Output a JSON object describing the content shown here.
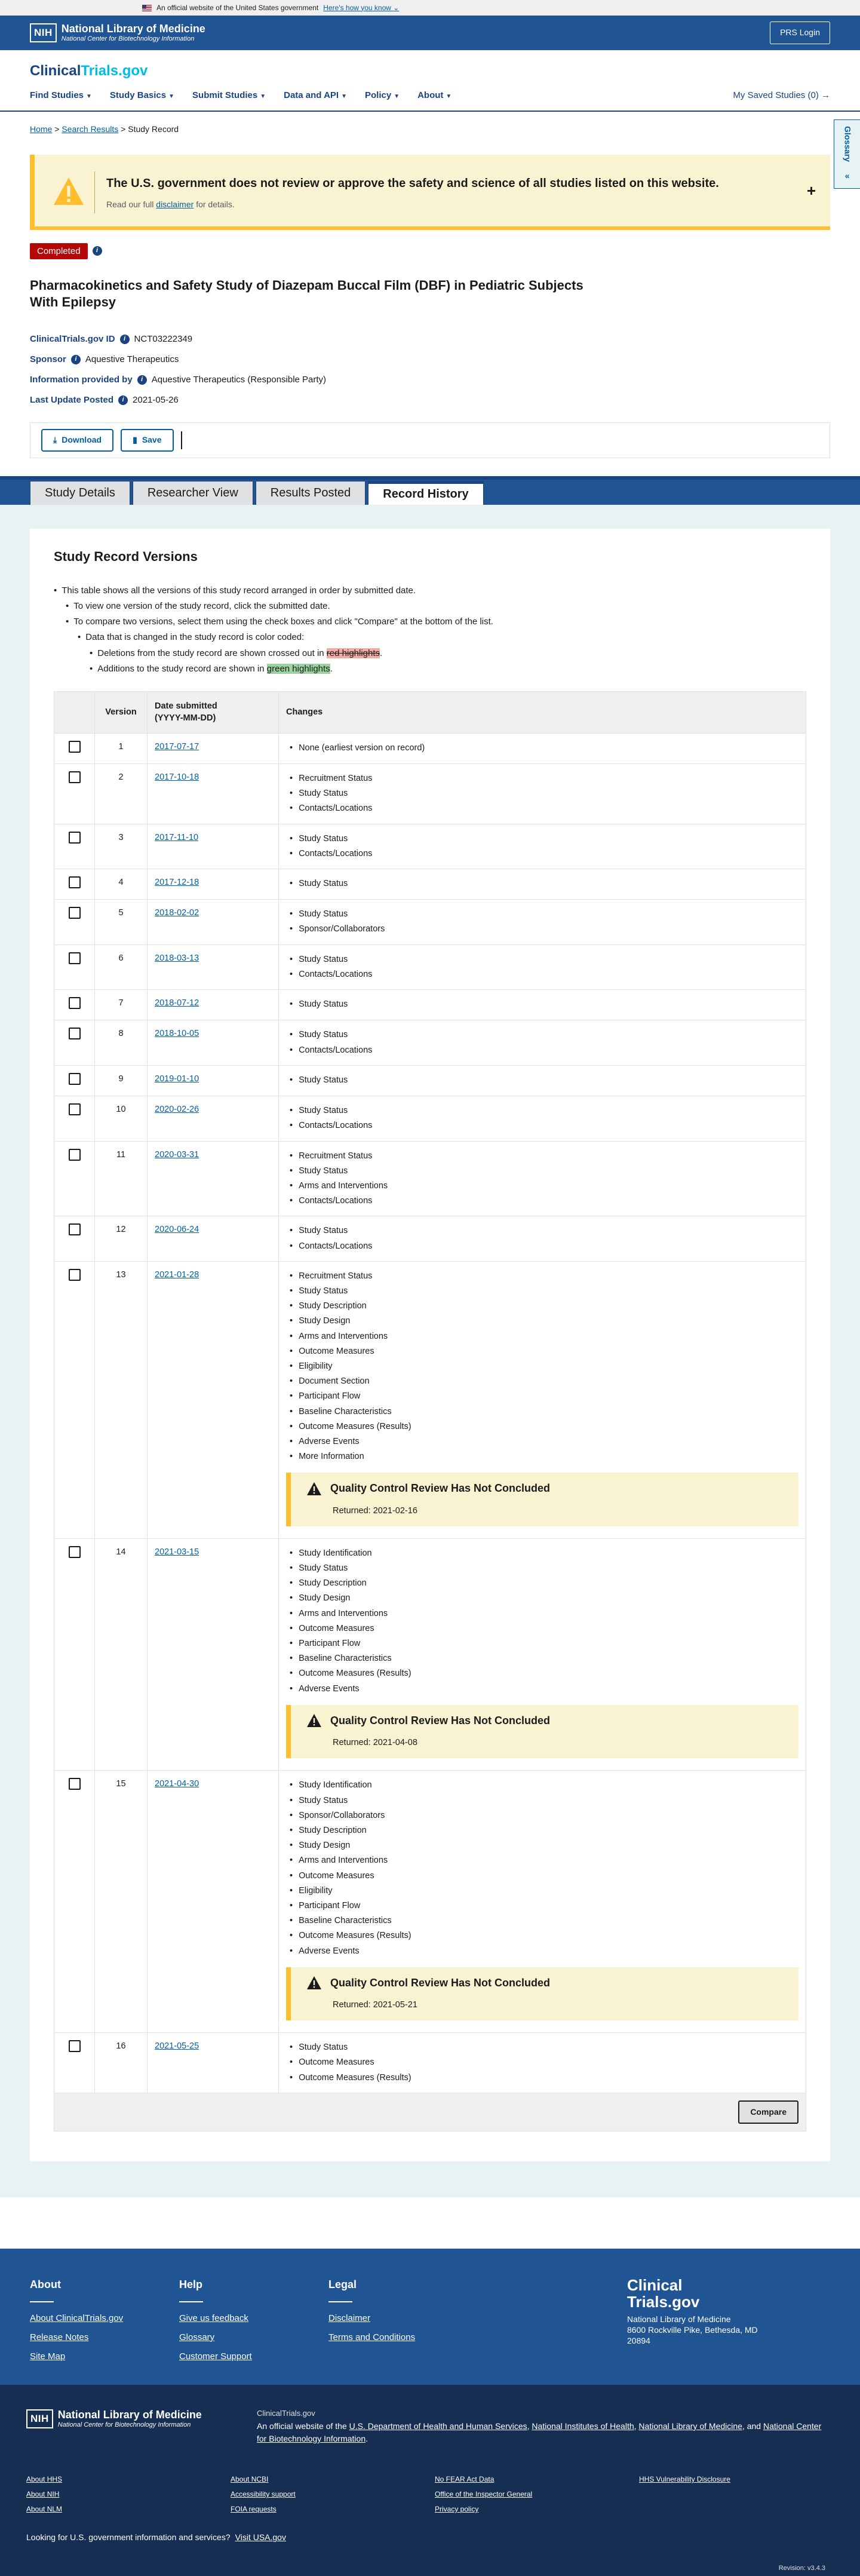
{
  "gov_banner": {
    "text": "An official website of the United States government",
    "link": "Here's how you know"
  },
  "nlm_header": {
    "nih": "NIH",
    "name": "National Library of Medicine",
    "sub": "National Center for Biotechnology Information",
    "login": "PRS Login"
  },
  "ct_header": {
    "logo_a": "Clinical",
    "logo_b": "Trials.gov",
    "nav": [
      "Find Studies",
      "Study Basics",
      "Submit Studies",
      "Data and API",
      "Policy",
      "About"
    ],
    "saved": "My Saved Studies (0)"
  },
  "breadcrumb": {
    "home": "Home",
    "search": "Search Results",
    "current": "Study Record"
  },
  "glossary": "Glossary",
  "alert": {
    "title": "The U.S. government does not review or approve the safety and science of all studies listed on this website.",
    "text_before": "Read our full",
    "link": "disclaimer",
    "text_after": "for details."
  },
  "status": "Completed",
  "title": "Pharmacokinetics and Safety Study of Diazepam Buccal Film (DBF) in Pediatric Subjects With Epilepsy",
  "meta": {
    "id_label": "ClinicalTrials.gov ID",
    "id": "NCT03222349",
    "sponsor_label": "Sponsor",
    "sponsor": "Aquestive Therapeutics",
    "provided_label": "Information provided by",
    "provided": "Aquestive Therapeutics (Responsible Party)",
    "posted_label": "Last Update Posted",
    "posted": "2021-05-26"
  },
  "actions": {
    "download": "Download",
    "save": "Save"
  },
  "tabs": [
    "Study Details",
    "Researcher View",
    "Results Posted",
    "Record History"
  ],
  "versions_section": {
    "heading": "Study Record Versions",
    "desc": {
      "l1": "This table shows all the versions of this study record arranged in order by submitted date.",
      "l2a": "To view one version of the study record, click the submitted date.",
      "l2b": "To compare two versions, select them using the check boxes and click \"Compare\" at the bottom of the list.",
      "l3": "Data that is changed in the study record is color coded:",
      "l4a_pre": "Deletions from the study record are shown crossed out in",
      "l4a_hl": "red highlights",
      "l4b_pre": "Additions to the study record are shown in",
      "l4b_hl": "green highlights"
    },
    "headers": {
      "version": "Version",
      "date1": "Date submitted",
      "date2": "(YYYY-MM-DD)",
      "changes": "Changes"
    },
    "qc_title": "Quality Control Review Has Not Concluded",
    "returned_label": "Returned:",
    "compare": "Compare"
  },
  "rows": [
    {
      "v": "1",
      "date": "2017-07-17",
      "changes": [
        "None (earliest version on record)"
      ]
    },
    {
      "v": "2",
      "date": "2017-10-18",
      "changes": [
        "Recruitment Status",
        "Study Status",
        "Contacts/Locations"
      ]
    },
    {
      "v": "3",
      "date": "2017-11-10",
      "changes": [
        "Study Status",
        "Contacts/Locations"
      ]
    },
    {
      "v": "4",
      "date": "2017-12-18",
      "changes": [
        "Study Status"
      ]
    },
    {
      "v": "5",
      "date": "2018-02-02",
      "changes": [
        "Study Status",
        "Sponsor/Collaborators"
      ]
    },
    {
      "v": "6",
      "date": "2018-03-13",
      "changes": [
        "Study Status",
        "Contacts/Locations"
      ]
    },
    {
      "v": "7",
      "date": "2018-07-12",
      "changes": [
        "Study Status"
      ]
    },
    {
      "v": "8",
      "date": "2018-10-05",
      "changes": [
        "Study Status",
        "Contacts/Locations"
      ]
    },
    {
      "v": "9",
      "date": "2019-01-10",
      "changes": [
        "Study Status"
      ]
    },
    {
      "v": "10",
      "date": "2020-02-26",
      "changes": [
        "Study Status",
        "Contacts/Locations"
      ]
    },
    {
      "v": "11",
      "date": "2020-03-31",
      "changes": [
        "Recruitment Status",
        "Study Status",
        "Arms and Interventions",
        "Contacts/Locations"
      ]
    },
    {
      "v": "12",
      "date": "2020-06-24",
      "changes": [
        "Study Status",
        "Contacts/Locations"
      ]
    },
    {
      "v": "13",
      "date": "2021-01-28",
      "changes": [
        "Recruitment Status",
        "Study Status",
        "Study Description",
        "Study Design",
        "Arms and Interventions",
        "Outcome Measures",
        "Eligibility",
        "Document Section",
        "Participant Flow",
        "Baseline Characteristics",
        "Outcome Measures (Results)",
        "Adverse Events",
        "More Information"
      ],
      "returned": "2021-02-16"
    },
    {
      "v": "14",
      "date": "2021-03-15",
      "changes": [
        "Study Identification",
        "Study Status",
        "Study Description",
        "Study Design",
        "Arms and Interventions",
        "Outcome Measures",
        "Participant Flow",
        "Baseline Characteristics",
        "Outcome Measures (Results)",
        "Adverse Events"
      ],
      "returned": "2021-04-08"
    },
    {
      "v": "15",
      "date": "2021-04-30",
      "changes": [
        "Study Identification",
        "Study Status",
        "Sponsor/Collaborators",
        "Study Description",
        "Study Design",
        "Arms and Interventions",
        "Outcome Measures",
        "Eligibility",
        "Participant Flow",
        "Baseline Characteristics",
        "Outcome Measures (Results)",
        "Adverse Events"
      ],
      "returned": "2021-05-21"
    },
    {
      "v": "16",
      "date": "2021-05-25",
      "changes": [
        "Study Status",
        "Outcome Measures",
        "Outcome Measures (Results)"
      ]
    }
  ],
  "footer": {
    "about_h": "About",
    "about": [
      "About ClinicalTrials.gov",
      "Release Notes",
      "Site Map"
    ],
    "help_h": "Help",
    "help": [
      "Give us feedback",
      "Glossary",
      "Customer Support"
    ],
    "legal_h": "Legal",
    "legal": [
      "Disclaimer",
      "Terms and Conditions"
    ],
    "logo_a": "Clinical",
    "logo_b": "Trials.gov",
    "addr": [
      "National Library of Medicine",
      "8600 Rockville Pike, Bethesda, MD",
      "20894"
    ]
  },
  "footer_bottom": {
    "nih": "NIH",
    "name": "National Library of Medicine",
    "sub": "National Center for Biotechnology Information",
    "site": "ClinicalTrials.gov",
    "official_pre": "An official website of the",
    "hhs": "U.S. Department of Health and Human Services",
    "nih_link": "National Institutes of Health",
    "nlm_link": "National Library of Medicine",
    "and": "and",
    "ncbi_link": "National Center for Biotechnology Information",
    "links": [
      "About HHS",
      "About NCBI",
      "No FEAR Act Data",
      "HHS Vulnerability Disclosure",
      "About NIH",
      "Accessibility support",
      "Office of the Inspector General",
      "",
      "About NLM",
      "FOIA requests",
      "Privacy policy",
      ""
    ],
    "usagov_pre": "Looking for U.S. government information and services?",
    "usagov_link": "Visit USA.gov",
    "revision": "Revision: v3.4.3"
  },
  "colors": {
    "primary": "#205493",
    "accent": "#005ea2",
    "warning": "#ffbe2e",
    "completed": "#b50909"
  }
}
